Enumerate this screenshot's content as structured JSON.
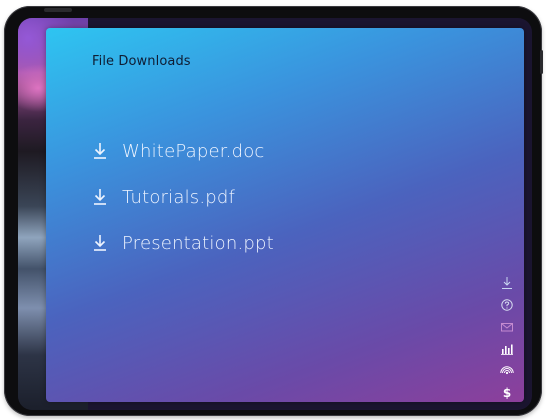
{
  "app": {
    "title": "File Downloads"
  },
  "files": [
    {
      "name": "WhitePaper.doc",
      "icon": "download-icon"
    },
    {
      "name": "Tutorials.pdf",
      "icon": "download-icon"
    },
    {
      "name": "Presentation.ppt",
      "icon": "download-icon"
    }
  ],
  "side_nav": [
    {
      "icon": "download-icon"
    },
    {
      "icon": "help-icon"
    },
    {
      "icon": "mail-icon"
    },
    {
      "icon": "bar-chart-icon"
    },
    {
      "icon": "broadcast-icon"
    },
    {
      "icon": "dollar-icon",
      "glyph": "$"
    }
  ],
  "colors": {
    "panel_gradient_start": "#2ec5f1",
    "panel_gradient_mid": "#4b63be",
    "panel_gradient_end": "#8d3f9b",
    "title_text": "#0f1d34",
    "file_text": "#eef4ff",
    "device_bezel": "#0d0d0f"
  }
}
